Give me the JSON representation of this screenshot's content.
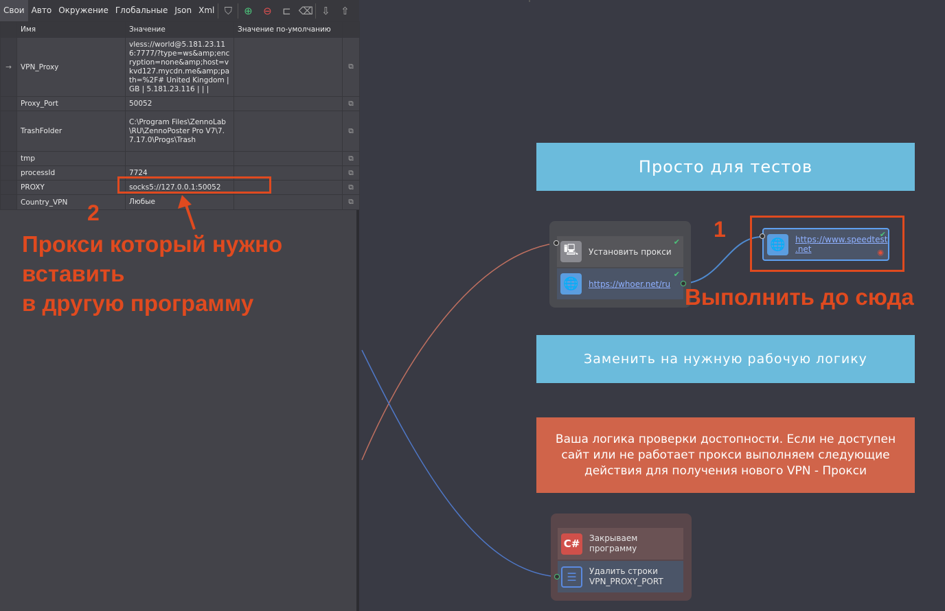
{
  "toolbar": {
    "tabs": [
      "Свои",
      "Авто",
      "Окружение",
      "Глобальные",
      "Json",
      "Xml"
    ],
    "icons": [
      "filter-icon",
      "add-icon",
      "remove-icon",
      "frame-icon",
      "eraser-icon",
      "move-down-icon",
      "move-up-icon"
    ]
  },
  "table": {
    "headers": [
      "Имя",
      "Значение",
      "Значение по-умолчанию"
    ],
    "rows": [
      {
        "name": "VPN_Proxy",
        "value": "vless://world@5.181.23.116:7777/?type=ws&amp;encryption=none&amp;host=vkvd127.mycdn.me&amp;path=%2F# United Kingdom | GB | 5.181.23.116 | | |",
        "default": ""
      },
      {
        "name": "Proxy_Port",
        "value": "50052",
        "default": ""
      },
      {
        "name": "TrashFolder",
        "value": "C:\\Program Files\\ZennoLab\\RU\\ZennoPoster Pro V7\\7.7.17.0\\Progs\\Trash",
        "default": ""
      },
      {
        "name": "tmp",
        "value": "",
        "default": ""
      },
      {
        "name": "processId",
        "value": "7724",
        "default": ""
      },
      {
        "name": "PROXY",
        "value": "socks5://127.0.0.1:50052",
        "default": ""
      },
      {
        "name": "Country_VPN",
        "value": "Любые",
        "default": ""
      }
    ],
    "row_arrow": "→"
  },
  "annotations": {
    "num2": "2",
    "text2_l1": "Прокси который нужно",
    "text2_l2": "вставить",
    "text2_l3": "в другую программу",
    "num1": "1",
    "text1": "Выполнить до сюда"
  },
  "canvas": {
    "banner1": "Просто для тестов",
    "banner2": "Заменить на нужную рабочую логику",
    "banner3": "Ваша логика проверки достопности. Если не доступен сайт или не работает прокси выполняем следующие действия для получения нового VPN - Прокси",
    "node_set_proxy": "Установить прокси",
    "node_whoer": "https://whoer.net/ru",
    "node_speedtest_l1": "https://www.speedtest",
    "node_speedtest_l2": ".net",
    "node_close_l1": "Закрываем",
    "node_close_l2": "программу",
    "node_delete_l1": "Удалить строки",
    "node_delete_l2": "VPN_PROXY_PORT",
    "csharp_label": "C#"
  },
  "colors": {
    "banner_blue": "#6bbbdc",
    "banner_red": "#d0644a",
    "annotation": "#e04a1f"
  }
}
